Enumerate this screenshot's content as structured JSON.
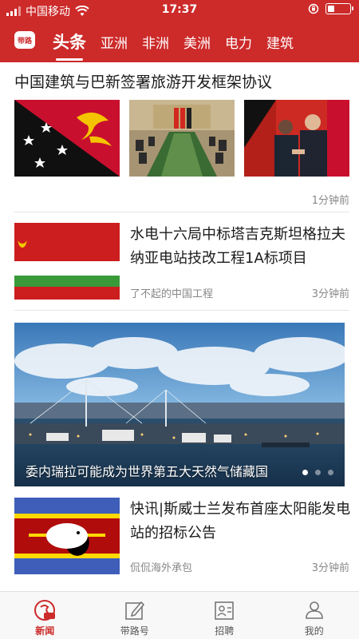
{
  "status_bar": {
    "carrier": "中国移动",
    "time": "17:37",
    "battery_level": 0.3
  },
  "nav": {
    "logo_text": "带路",
    "tabs": [
      {
        "label": "头条",
        "active": true
      },
      {
        "label": "亚洲"
      },
      {
        "label": "非洲"
      },
      {
        "label": "美洲"
      },
      {
        "label": "电力"
      },
      {
        "label": "建筑"
      }
    ]
  },
  "articles": [
    {
      "title": "中国建筑与巴新签署旅游开发框架协议",
      "images": [
        "png-flag",
        "signing-meeting",
        "leaders-handshake"
      ],
      "time": "1分钟前"
    },
    {
      "title": "水电十六局中标塔吉克斯坦格拉夫纳亚电站技改工程1A标项目",
      "image": "tajikistan-ussr-flag",
      "source": "了不起的中国工程",
      "time": "3分钟前"
    },
    {
      "title": "快讯|斯威士兰发布首座太阳能发电站的招标公告",
      "image": "eswatini-flag",
      "source": "侃侃海外承包",
      "time": "3分钟前"
    }
  ],
  "banner": {
    "caption": "委内瑞拉可能成为世界第五大天然气储藏国",
    "image": "harbor-night-skyline",
    "dots": 3,
    "active_dot": 0
  },
  "tabbar": {
    "items": [
      {
        "label": "新闻",
        "icon": "news-icon",
        "active": true
      },
      {
        "label": "带路号",
        "icon": "edit-icon"
      },
      {
        "label": "招聘",
        "icon": "recruit-icon"
      },
      {
        "label": "我的",
        "icon": "profile-icon"
      }
    ]
  },
  "colors": {
    "brand_red": "#cd2a2a",
    "text": "#1a1a1a",
    "meta": "#888888"
  }
}
